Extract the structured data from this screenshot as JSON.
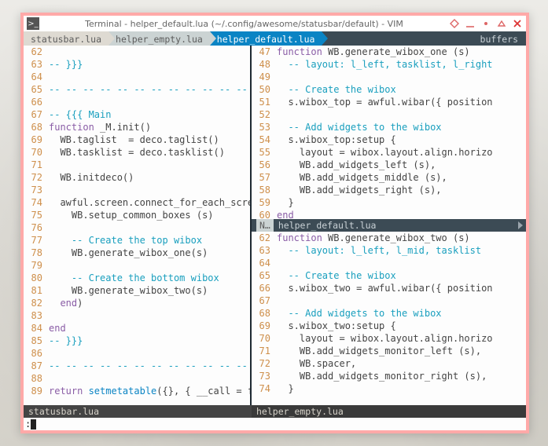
{
  "window": {
    "title": "Terminal - helper_default.lua (~/.config/awesome/statusbar/default) - VIM",
    "app_icon_glyph": ">_"
  },
  "colors": {
    "frame_border": "#ffa9a8",
    "tab_active": "#0a84c4",
    "tabbar_bg": "#3c4b55",
    "line_number": "#ce8f4b",
    "comment": "#199fbe",
    "keyword": "#8a5da6"
  },
  "tabs": {
    "items": [
      {
        "label": "statusbar.lua",
        "active": false
      },
      {
        "label": "helper_empty.lua",
        "active": false
      },
      {
        "label": "helper_default.lua",
        "active": true
      }
    ],
    "right_label": "buffers"
  },
  "left_pane": {
    "status": "statusbar.lua",
    "lines": [
      {
        "n": 62,
        "cls": "plain",
        "t": ""
      },
      {
        "n": 63,
        "cls": "comment",
        "t": "-- }}}"
      },
      {
        "n": 64,
        "cls": "plain",
        "t": ""
      },
      {
        "n": 65,
        "cls": "comment",
        "t": "-- -- -- -- -- -- -- -- -- -- -- -- --"
      },
      {
        "n": 66,
        "cls": "plain",
        "t": ""
      },
      {
        "n": 67,
        "cls": "comment",
        "t": "-- {{{ Main"
      },
      {
        "n": 68,
        "cls": "kwline",
        "kw": "function",
        "rest": " _M.init()"
      },
      {
        "n": 69,
        "cls": "plain",
        "t": "  WB.taglist  = deco.taglist()"
      },
      {
        "n": 70,
        "cls": "plain",
        "t": "  WB.tasklist = deco.tasklist()"
      },
      {
        "n": 71,
        "cls": "plain",
        "t": ""
      },
      {
        "n": 72,
        "cls": "plain",
        "t": "  WB.initdeco()"
      },
      {
        "n": 73,
        "cls": "plain",
        "t": ""
      },
      {
        "n": 74,
        "cls": "plain",
        "t": "  awful.screen.connect_for_each_screen"
      },
      {
        "n": 75,
        "cls": "plain",
        "t": "    WB.setup_common_boxes (s)"
      },
      {
        "n": 76,
        "cls": "plain",
        "t": ""
      },
      {
        "n": 77,
        "cls": "comment",
        "t": "    -- Create the top wibox"
      },
      {
        "n": 78,
        "cls": "plain",
        "t": "    WB.generate_wibox_one(s)"
      },
      {
        "n": 79,
        "cls": "plain",
        "t": ""
      },
      {
        "n": 80,
        "cls": "comment",
        "t": "    -- Create the bottom wibox"
      },
      {
        "n": 81,
        "cls": "plain",
        "t": "    WB.generate_wibox_two(s)"
      },
      {
        "n": 82,
        "cls": "kwline",
        "kw": "  end",
        "rest": ")"
      },
      {
        "n": 83,
        "cls": "plain",
        "t": ""
      },
      {
        "n": 84,
        "cls": "kwline",
        "kw": "end",
        "rest": ""
      },
      {
        "n": 85,
        "cls": "comment",
        "t": "-- }}}"
      },
      {
        "n": 86,
        "cls": "plain",
        "t": ""
      },
      {
        "n": 87,
        "cls": "comment",
        "t": "-- -- -- -- -- -- -- -- -- -- -- -- --"
      },
      {
        "n": 88,
        "cls": "plain",
        "t": ""
      },
      {
        "n": 89,
        "cls": "retline",
        "kw": "return ",
        "fn": "setmetatable",
        "rest": "({}, { __call = fun"
      }
    ]
  },
  "right_top": {
    "lines": [
      {
        "n": 47,
        "cls": "kwline",
        "kw": "function",
        "rest": " WB.generate_wibox_one (s)"
      },
      {
        "n": 48,
        "cls": "comment",
        "t": "  -- layout: l_left, tasklist, l_right"
      },
      {
        "n": 49,
        "cls": "plain",
        "t": ""
      },
      {
        "n": 50,
        "cls": "comment",
        "t": "  -- Create the wibox"
      },
      {
        "n": 51,
        "cls": "plain",
        "t": "  s.wibox_top = awful.wibar({ position"
      },
      {
        "n": 52,
        "cls": "plain",
        "t": ""
      },
      {
        "n": 53,
        "cls": "comment",
        "t": "  -- Add widgets to the wibox"
      },
      {
        "n": 54,
        "cls": "plain",
        "t": "  s.wibox_top:setup {"
      },
      {
        "n": 55,
        "cls": "plain",
        "t": "    layout = wibox.layout.align.horizo"
      },
      {
        "n": 56,
        "cls": "plain",
        "t": "    WB.add_widgets_left (s),"
      },
      {
        "n": 57,
        "cls": "plain",
        "t": "    WB.add_widgets_middle (s),"
      },
      {
        "n": 58,
        "cls": "plain",
        "t": "    WB.add_widgets_right (s),"
      },
      {
        "n": 59,
        "cls": "plain",
        "t": "  }"
      },
      {
        "n": 60,
        "cls": "kwline",
        "kw": "end",
        "rest": ""
      }
    ]
  },
  "right_split": {
    "tag": "N…",
    "label": "helper_default.lua"
  },
  "right_bottom": {
    "status": "helper_empty.lua",
    "lines": [
      {
        "n": 62,
        "cls": "kwline",
        "kw": "function",
        "rest": " WB.generate_wibox_two (s)"
      },
      {
        "n": 63,
        "cls": "comment",
        "t": "  -- layout: l_left, l_mid, tasklist"
      },
      {
        "n": 64,
        "cls": "plain",
        "t": ""
      },
      {
        "n": 65,
        "cls": "comment",
        "t": "  -- Create the wibox"
      },
      {
        "n": 66,
        "cls": "plain",
        "t": "  s.wibox_two = awful.wibar({ position"
      },
      {
        "n": 67,
        "cls": "plain",
        "t": ""
      },
      {
        "n": 68,
        "cls": "comment",
        "t": "  -- Add widgets to the wibox"
      },
      {
        "n": 69,
        "cls": "plain",
        "t": "  s.wibox_two:setup {"
      },
      {
        "n": 70,
        "cls": "plain",
        "t": "    layout = wibox.layout.align.horizo"
      },
      {
        "n": 71,
        "cls": "plain",
        "t": "    WB.add_widgets_monitor_left (s),"
      },
      {
        "n": 72,
        "cls": "plain",
        "t": "    WB.spacer,"
      },
      {
        "n": 73,
        "cls": "plain",
        "t": "    WB.add_widgets_monitor_right (s),"
      },
      {
        "n": 74,
        "cls": "plain",
        "t": "  }"
      }
    ]
  },
  "cmdline": {
    "prefix": ":"
  }
}
